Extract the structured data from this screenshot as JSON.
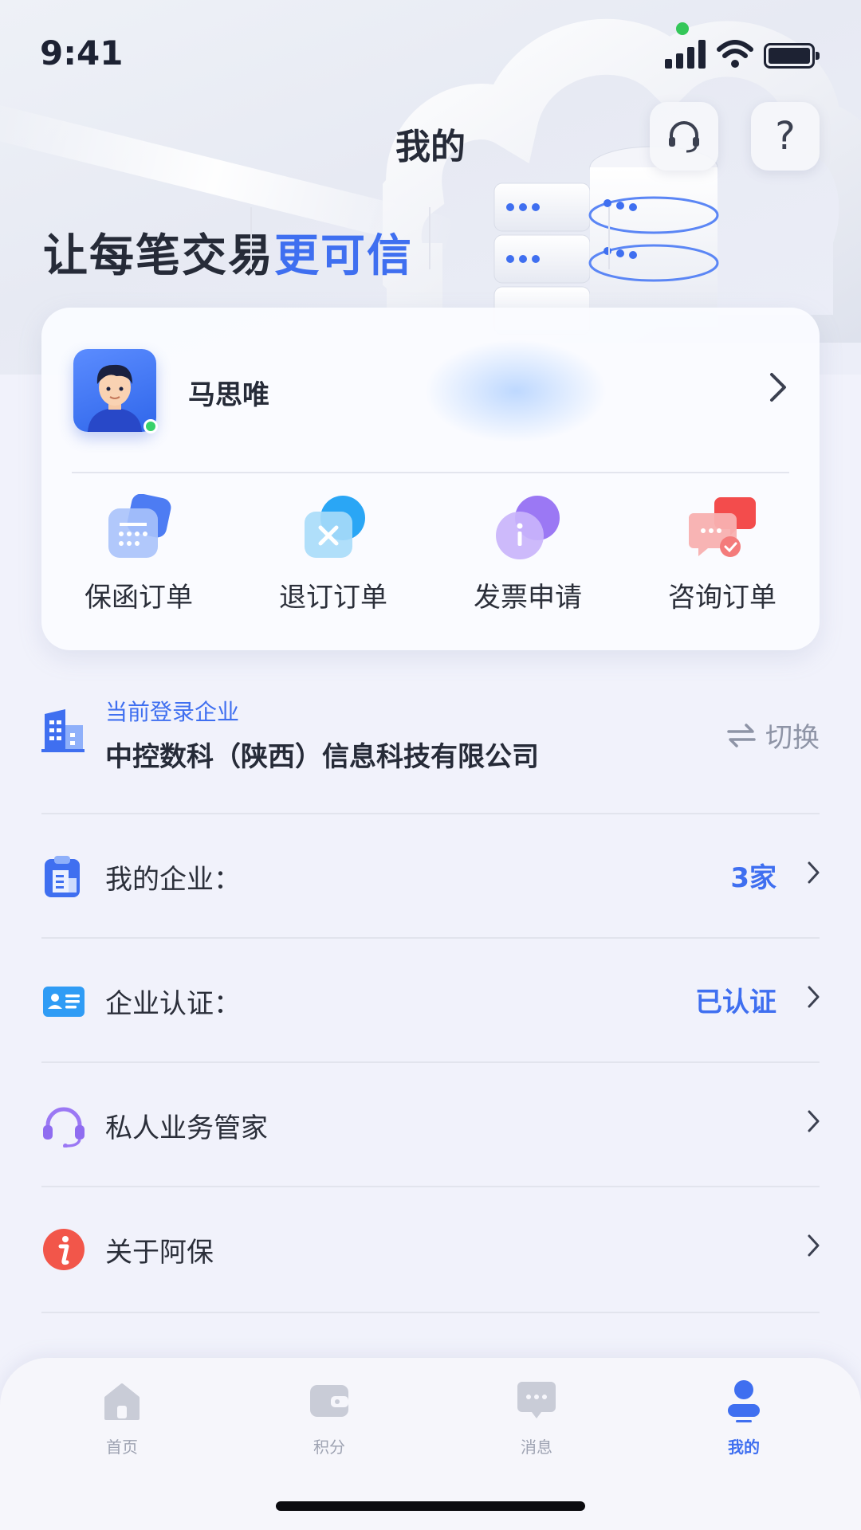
{
  "status_bar": {
    "time": "9:41"
  },
  "header": {
    "title": "我的",
    "slogan_main": "让每笔交易",
    "slogan_highlight": "更可信",
    "help_label": "?"
  },
  "profile": {
    "name": "马思唯"
  },
  "shortcuts": [
    {
      "label": "保函订单",
      "icon": "calendar-order-icon"
    },
    {
      "label": "退订订单",
      "icon": "cancel-order-icon"
    },
    {
      "label": "发票申请",
      "icon": "invoice-info-icon"
    },
    {
      "label": "咨询订单",
      "icon": "chat-consult-icon"
    }
  ],
  "company": {
    "caption": "当前登录企业",
    "name": "中控数科（陕西）信息科技有限公司",
    "switch_label": "切换"
  },
  "menu": [
    {
      "label": "我的企业：",
      "value": "3家",
      "icon": "enterprise-clipboard-icon"
    },
    {
      "label": "企业认证：",
      "value": "已认证",
      "icon": "id-card-icon"
    },
    {
      "label": "私人业务管家",
      "value": "",
      "icon": "headset-icon"
    },
    {
      "label": "关于阿保",
      "value": "",
      "icon": "info-icon"
    }
  ],
  "tabs": [
    {
      "label": "首页",
      "icon": "home-icon"
    },
    {
      "label": "积分",
      "icon": "wallet-icon"
    },
    {
      "label": "消息",
      "icon": "message-icon"
    },
    {
      "label": "我的",
      "icon": "user-icon",
      "active": true
    }
  ],
  "colors": {
    "accent": "#3f6ff0",
    "text": "#262b38",
    "muted": "#9ea3b2"
  }
}
